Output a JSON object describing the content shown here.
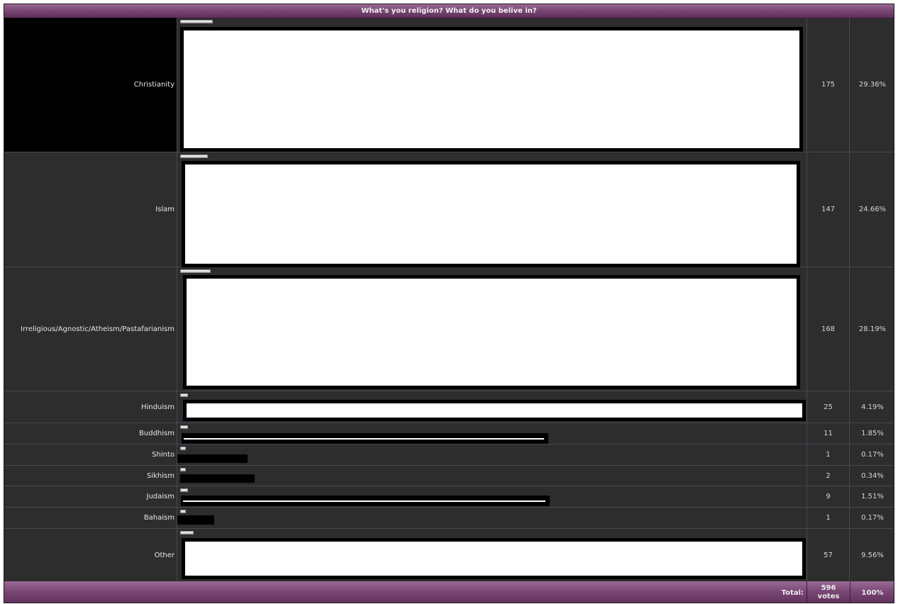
{
  "poll": {
    "title": "What's you religion? What do you belive in?",
    "options": [
      {
        "label": "Christianity",
        "votes": "175",
        "percent": "29.36%"
      },
      {
        "label": "Islam",
        "votes": "147",
        "percent": "24.66%"
      },
      {
        "label": "Irreligious/Agnostic/Atheism/Pastafarianism",
        "votes": "168",
        "percent": "28.19%"
      },
      {
        "label": "Hinduism",
        "votes": "25",
        "percent": "4.19%"
      },
      {
        "label": "Buddhism",
        "votes": "11",
        "percent": "1.85%"
      },
      {
        "label": "Shinto",
        "votes": "1",
        "percent": "0.17%"
      },
      {
        "label": "Sikhism",
        "votes": "2",
        "percent": "0.34%"
      },
      {
        "label": "Judaism",
        "votes": "9",
        "percent": "1.51%"
      },
      {
        "label": "Bahaism",
        "votes": "1",
        "percent": "0.17%"
      },
      {
        "label": "Other",
        "votes": "57",
        "percent": "9.56%"
      }
    ],
    "total": {
      "label": "Total:",
      "votes_number": "596",
      "votes_unit": "votes",
      "percent": "100%"
    }
  },
  "colors": {
    "header": "#7a4775",
    "row_background": "#2d2d2d",
    "selected_label_background": "#000000",
    "bar_fill": "#ffffff"
  }
}
